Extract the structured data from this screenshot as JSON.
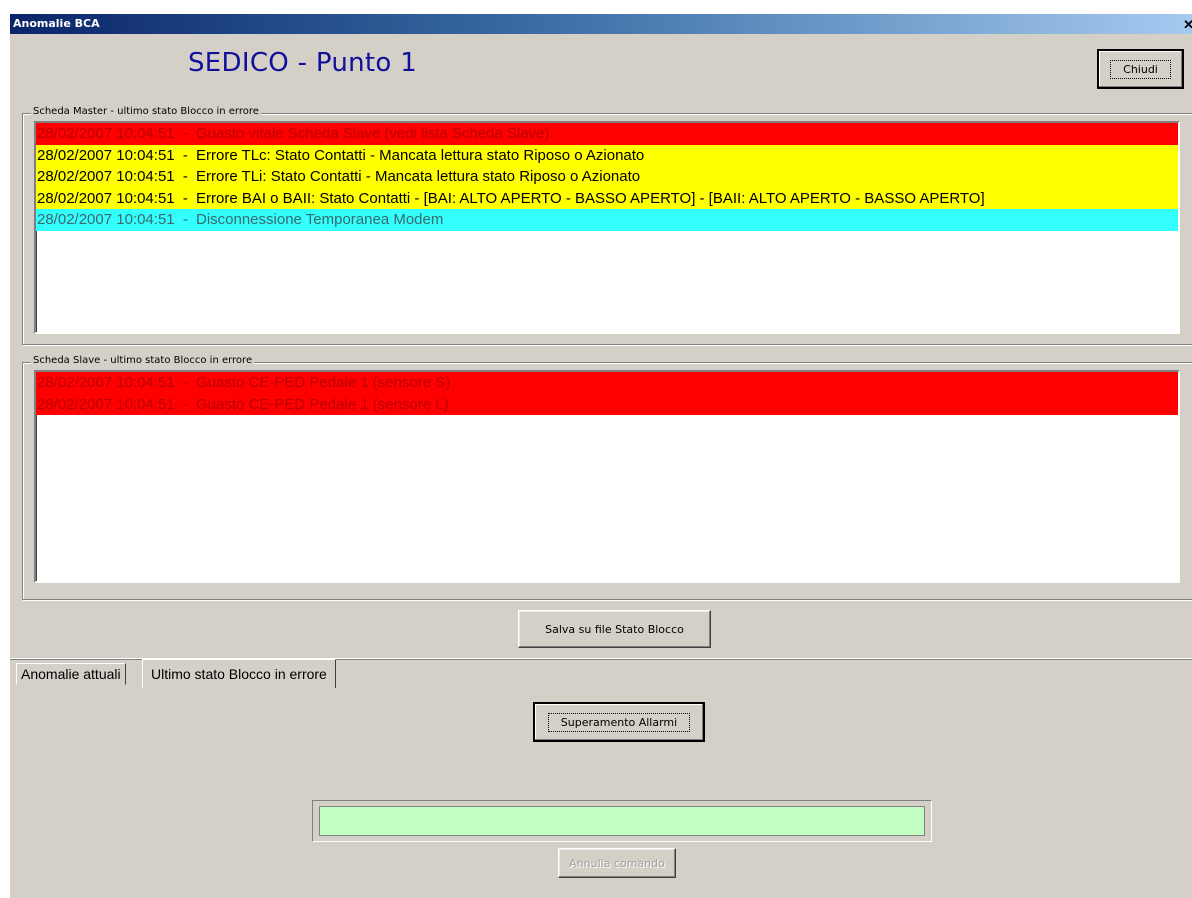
{
  "window": {
    "title": "Anomalie BCA",
    "close_glyph": "✕"
  },
  "header": {
    "title": "SEDICO - Punto 1",
    "close_button": "Chiudi"
  },
  "master": {
    "legend": "Scheda Master - ultimo stato Blocco in errore",
    "rows": [
      {
        "time": "28/02/2007 10:04:51",
        "sep": "-",
        "text": "Guasto vitale Scheda Slave (vedi lista Scheda Slave)",
        "bg": "#ff0000",
        "fg": "#b80000"
      },
      {
        "time": "28/02/2007 10:04:51",
        "sep": "-",
        "text": "Errore TLc: Stato Contatti - Mancata lettura stato Riposo o Azionato",
        "bg": "#ffff00",
        "fg": "#000000"
      },
      {
        "time": "28/02/2007 10:04:51",
        "sep": "-",
        "text": "Errore TLi: Stato Contatti - Mancata lettura stato Riposo o Azionato",
        "bg": "#ffff00",
        "fg": "#000000"
      },
      {
        "time": "28/02/2007 10:04:51",
        "sep": "-",
        "text": "Errore BAI o BAII: Stato Contatti - [BAI: ALTO APERTO - BASSO APERTO] - [BAII: ALTO APERTO - BASSO APERTO]",
        "bg": "#ffff00",
        "fg": "#000000"
      },
      {
        "time": "28/02/2007 10:04:51",
        "sep": "-",
        "text": "Disconnessione Temporanea Modem",
        "bg": "#33ffff",
        "fg": "#3a6a6a"
      }
    ]
  },
  "slave": {
    "legend": "Scheda Slave - ultimo stato Blocco in errore",
    "rows": [
      {
        "time": "28/02/2007 10:04:51",
        "sep": "-",
        "text": "Guasto CE-PED Pedale 1 (sensore S)",
        "bg": "#ff0000",
        "fg": "#b80000"
      },
      {
        "time": "28/02/2007 10:04:51",
        "sep": "-",
        "text": "Guasto CE-PED Pedale 1 (sensore L)",
        "bg": "#ff0000",
        "fg": "#b80000"
      }
    ]
  },
  "save_button": "Salva su file Stato Blocco",
  "tabs": [
    {
      "label": "Anomalie attuali",
      "active": false
    },
    {
      "label": "Ultimo stato Blocco in errore",
      "active": true
    }
  ],
  "override_button": "Superamento Allarmi",
  "progress": {
    "value": 1.0,
    "color": "#c3ffc3"
  },
  "cancel_button": "Annulla comando"
}
